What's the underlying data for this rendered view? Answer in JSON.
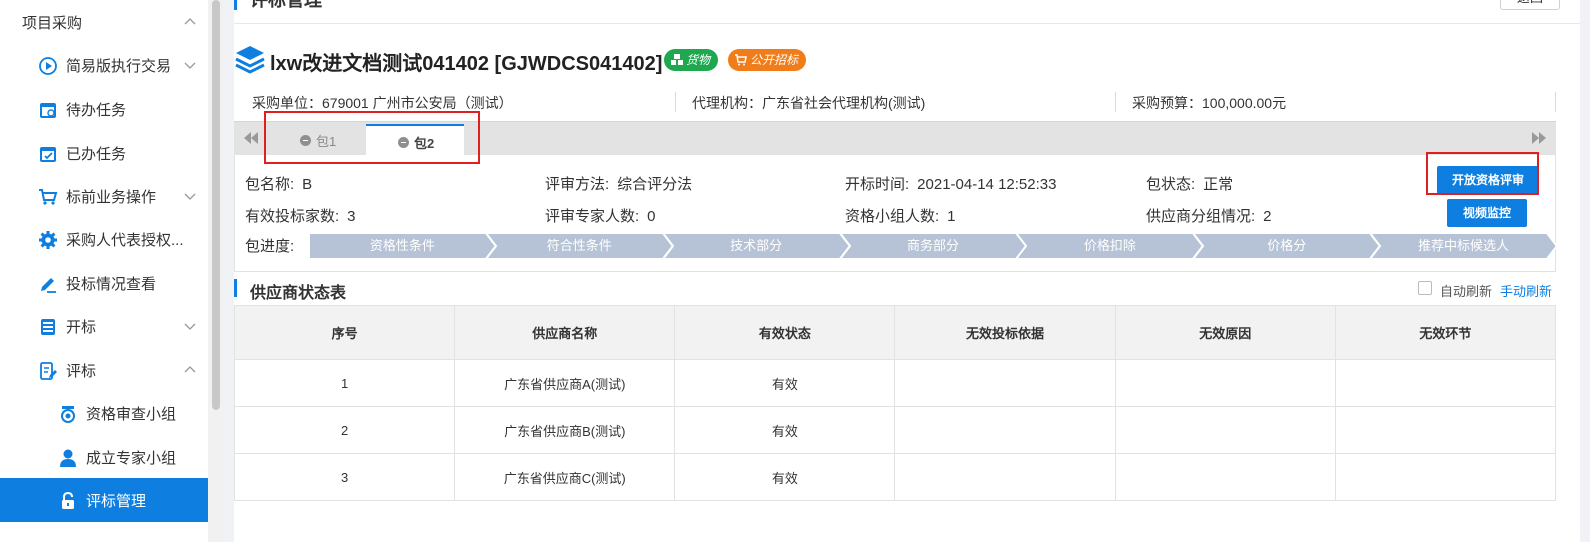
{
  "sidebar": {
    "group_label": "项目采购",
    "items": [
      {
        "label": "简易版执行交易",
        "icon": "play-circle-icon",
        "expandable": true
      },
      {
        "label": "待办任务",
        "icon": "todo-calendar-icon",
        "expandable": false
      },
      {
        "label": "已办任务",
        "icon": "done-calendar-icon",
        "expandable": false
      },
      {
        "label": "标前业务操作",
        "icon": "cart-icon",
        "expandable": true
      },
      {
        "label": "采购人代表授权...",
        "icon": "gear-icon",
        "expandable": false
      },
      {
        "label": "投标情况查看",
        "icon": "pen-icon",
        "expandable": false
      },
      {
        "label": "开标",
        "icon": "document-stack-icon",
        "expandable": true
      },
      {
        "label": "评标",
        "icon": "edit-document-icon",
        "expandable": true,
        "expanded": true
      }
    ],
    "sub_items": [
      {
        "label": "资格审查小组",
        "icon": "badge-icon"
      },
      {
        "label": "成立专家小组",
        "icon": "user-icon"
      },
      {
        "label": "评标管理",
        "icon": "lock-icon",
        "active": true
      }
    ]
  },
  "page": {
    "title": "评标管理",
    "back_label": "返回"
  },
  "project": {
    "name": "lxw改进文档测试041402 [GJWDCS041402]",
    "tags": [
      {
        "label": "货物",
        "color": "#1fa84f",
        "icon": "cubes-icon"
      },
      {
        "label": "公开招标",
        "color": "#f07d1a",
        "icon": "cart-icon"
      }
    ],
    "info": [
      {
        "label": "采购单位：",
        "value": "679001 广州市公安局（测试）"
      },
      {
        "label": "代理机构：",
        "value": "广东省社会代理机构(测试)"
      },
      {
        "label": "采购预算：",
        "value": "100,000.00元"
      }
    ]
  },
  "tabs": [
    {
      "label": "包1",
      "active": false
    },
    {
      "label": "包2",
      "active": true
    }
  ],
  "package": {
    "name_label": "包名称:",
    "name_value": "B",
    "method_label": "评审方法:",
    "method_value": "综合评分法",
    "open_time_label": "开标时间:",
    "open_time_value": "2021-04-14 12:52:33",
    "status_label": "包状态:",
    "status_value": "正常",
    "bidders_label": "有效投标家数:",
    "bidders_value": "3",
    "experts_label": "评审专家人数:",
    "experts_value": "0",
    "qual_group_label": "资格小组人数:",
    "qual_group_value": "1",
    "supplier_group_label": "供应商分组情况:",
    "supplier_group_value": "2",
    "open_qual_review_btn": "开放资格评审",
    "video_monitor_btn": "视频监控",
    "progress_label": "包进度:",
    "progress_steps": [
      "资格性条件",
      "符合性条件",
      "技术部分",
      "商务部分",
      "价格扣除",
      "价格分",
      "推荐中标候选人"
    ]
  },
  "supplier_table": {
    "title": "供应商状态表",
    "auto_refresh_label": "自动刷新",
    "manual_refresh_label": "手动刷新",
    "columns": [
      "序号",
      "供应商名称",
      "有效状态",
      "无效投标依据",
      "无效原因",
      "无效环节"
    ],
    "rows": [
      [
        "1",
        "广东省供应商A(测试)",
        "有效",
        "",
        "",
        ""
      ],
      [
        "2",
        "广东省供应商B(测试)",
        "有效",
        "",
        "",
        ""
      ],
      [
        "3",
        "广东省供应商C(测试)",
        "有效",
        "",
        "",
        ""
      ]
    ]
  },
  "colors": {
    "accent": "#0e7fe0",
    "highlight_box": "#e02020",
    "step_fill": "#b6c3d6"
  }
}
